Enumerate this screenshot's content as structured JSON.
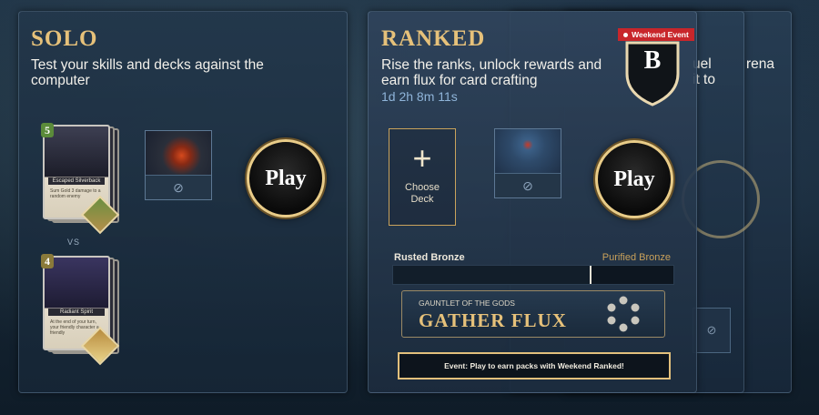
{
  "solo": {
    "title": "SOLO",
    "description": "Test your skills and decks against the computer",
    "play_label": "Play",
    "player_card": {
      "cost": "5",
      "name": "Escaped Silverback",
      "text": "Sum Gold 3 damage to a random enemy"
    },
    "vs_label": "VS",
    "opponent_card": {
      "cost": "4",
      "name": "Radiant Spirit",
      "text": "At the end of your turn, your friendly character a friendly"
    },
    "deck_thumb_icon": "ban-icon"
  },
  "ranked": {
    "title": "RANKED",
    "description": "Rise the ranks, unlock rewards and earn flux for card crafting",
    "timer": "1d 2h 8m 11s",
    "badge_label": "Weekend Event",
    "rank_letter": "B",
    "choose_deck_label": "Choose Deck",
    "choose_deck_icon": "plus-icon",
    "play_label": "Play",
    "rank_current": "Rusted Bronze",
    "rank_next": "Purified Bronze",
    "rank_progress": 0.7,
    "quest_subtitle": "GAUNTLET OF THE GODS",
    "quest_title": "GATHER FLUX",
    "event_banner": "Event: Play to earn packs with Weekend Ranked!",
    "colors": {
      "gold": "#e6c17a",
      "timer": "#8fb4d9",
      "badge": "#c8262b"
    }
  },
  "behind_cards": {
    "fragment1": "uel",
    "fragment2": "rena",
    "fragment3": "it to"
  }
}
